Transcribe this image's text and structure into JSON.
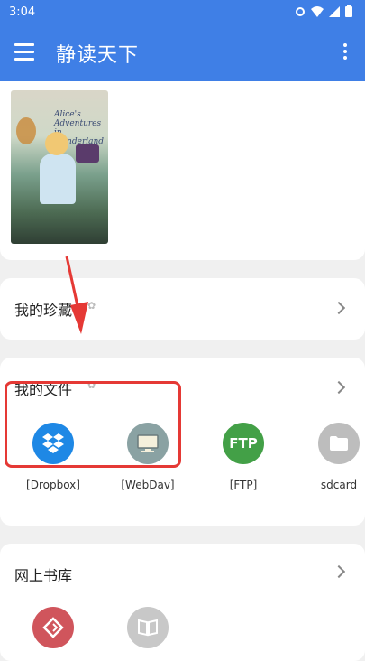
{
  "status": {
    "time": "3:04"
  },
  "appbar": {
    "title": "静读天下"
  },
  "sections": {
    "favorites": {
      "title": "我的珍藏"
    },
    "files": {
      "title": "我的文件",
      "sources": [
        {
          "label": "[Dropbox]",
          "icon": "dropbox-icon"
        },
        {
          "label": "[WebDav]",
          "icon": "monitor-icon"
        },
        {
          "label": "[FTP]",
          "icon": "ftp-icon",
          "icon_text": "FTP"
        },
        {
          "label": "sdcard",
          "icon": "folder-icon"
        }
      ]
    },
    "library": {
      "title": "网上书库"
    }
  },
  "recent_book": {
    "cover_title_line1": "Alice's",
    "cover_title_line2": "Adventures",
    "cover_title_line3": "in Wonderland"
  },
  "colors": {
    "appbar": "#3f7fe6",
    "dropbox": "#1e88e5",
    "webdav": "#8aa2a3",
    "ftp": "#43a047",
    "folder": "#bdbdbd",
    "gutenberg": "#d0555c",
    "library_gray": "#c8c8c8",
    "annotation_red": "#e53935"
  }
}
